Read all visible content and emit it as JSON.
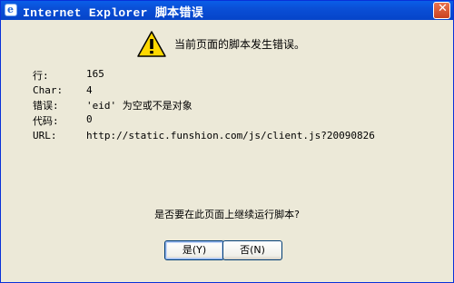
{
  "window": {
    "title": "Internet Explorer 脚本错误"
  },
  "message": "当前页面的脚本发生错误。",
  "details": [
    {
      "label": "行:",
      "value": "165"
    },
    {
      "label": "Char:",
      "value": "4"
    },
    {
      "label": "错误:",
      "value": "'eid' 为空或不是对象"
    },
    {
      "label": "代码:",
      "value": "0"
    },
    {
      "label": "URL:",
      "value": "http://static.funshion.com/js/client.js?20090826"
    }
  ],
  "question": "是否要在此页面上继续运行脚本?",
  "buttons": {
    "yes": "是(Y)",
    "no": "否(N)"
  },
  "colors": {
    "titlebar": "#0a4fd6",
    "dialog_bg": "#ece9d8",
    "warning_yellow": "#ffd800"
  }
}
